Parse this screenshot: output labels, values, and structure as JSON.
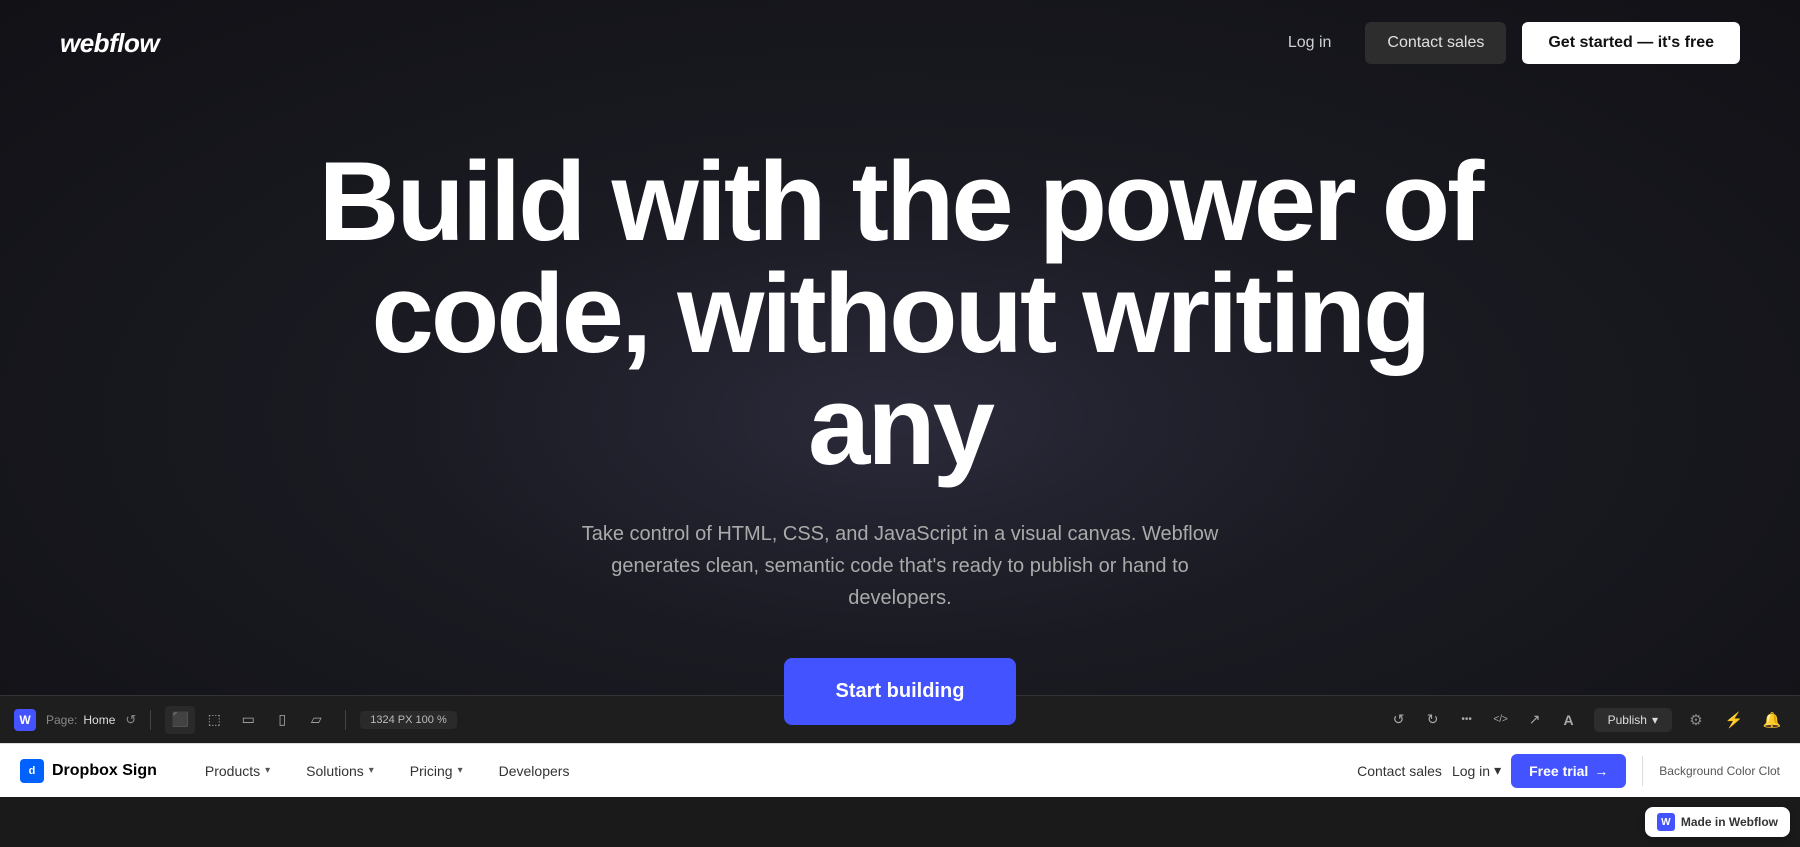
{
  "nav": {
    "logo": "webflow",
    "login_label": "Log in",
    "contact_label": "Contact sales",
    "get_started_label": "Get started — it's free"
  },
  "hero": {
    "title_line1": "Build with the power of",
    "title_line2": "code, without writing any",
    "subtitle": "Take control of HTML, CSS, and JavaScript in a visual canvas. Webflow generates clean, semantic code that's ready to publish or hand to developers.",
    "cta_label": "Start building"
  },
  "editor_bar": {
    "logo": "W",
    "page_prefix": "Page:",
    "page_name": "Home",
    "resolution": "1324 PX  100 %",
    "publish_label": "Publish"
  },
  "browser_bar": {
    "logo_text": "Dropbox Sign",
    "nav_items": [
      {
        "label": "Products",
        "has_chevron": true
      },
      {
        "label": "Solutions",
        "has_chevron": true
      },
      {
        "label": "Pricing",
        "has_chevron": true
      },
      {
        "label": "Developers",
        "has_chevron": false
      }
    ],
    "contact_label": "Contact sales",
    "login_label": "Log in",
    "login_chevron": true,
    "free_trial_label": "Free trial",
    "bg_color_label": "Background Color Clot"
  },
  "made_in_webflow": {
    "logo": "W",
    "label": "Made in Webflow"
  },
  "icons": {
    "desktop": "▣",
    "tablet": "⊡",
    "mobile_land": "⬚",
    "mobile_port": "▯",
    "undo": "↺",
    "redo": "↻",
    "dots": "•••",
    "code": "</>",
    "share": "↗",
    "text": "A",
    "chevron_down": "▾",
    "gear": "⚙",
    "lightning": "⚡",
    "arrow_right": "→"
  }
}
